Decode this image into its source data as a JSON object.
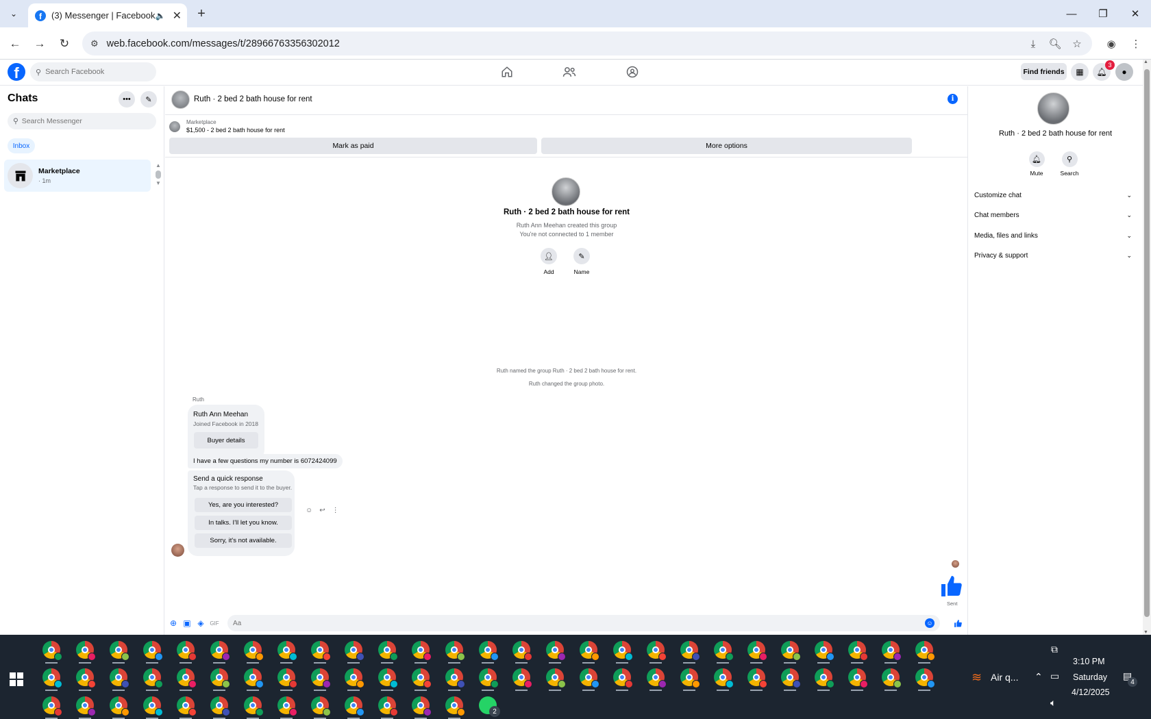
{
  "browser": {
    "tab_title": "(3) Messenger | Facebook",
    "url": "web.facebook.com/messages/t/28966763356302012"
  },
  "facebook": {
    "search_placeholder": "Search Facebook",
    "find_friends": "Find friends",
    "notification_count": "3"
  },
  "left": {
    "heading": "Chats",
    "search_placeholder": "Search Messenger",
    "filter": "Inbox",
    "chats": [
      {
        "name": "Marketplace",
        "time": "· 1m"
      }
    ]
  },
  "conversation": {
    "title": "Ruth · 2 bed 2 bath house for rent",
    "marketplace_label": "Marketplace",
    "listing": "$1,500 - 2 bed 2 bath house for rent",
    "mark_paid": "Mark as paid",
    "more_options": "More options",
    "hero_title": "Ruth · 2 bed 2 bath house for rent",
    "hero_created": "Ruth Ann Meehan created this group",
    "hero_connected": "You're not connected to 1 member",
    "add_label": "Add",
    "name_label": "Name",
    "system_messages": [
      "Ruth named the group Ruth · 2 bed 2 bath house for rent.",
      "Ruth changed the group photo."
    ],
    "sender": "Ruth",
    "card_name": "Ruth Ann Meehan",
    "card_joined": "Joined Facebook in 2018",
    "card_button": "Buyer details",
    "message": "I have a few questions my number is 6072424099",
    "quick_title": "Send a quick response",
    "quick_subtitle": "Tap a response to send it to the buyer.",
    "quick_responses": [
      "Yes, are you interested?",
      "In talks. I'll let you know.",
      "Sorry, it's not available."
    ],
    "sent_label": "Sent",
    "composer_placeholder": "Aa"
  },
  "right": {
    "title": "Ruth · 2 bed 2 bath house for rent",
    "mute": "Mute",
    "search": "Search",
    "sections": [
      "Customize chat",
      "Chat members",
      "Media, files and links",
      "Privacy & support"
    ]
  },
  "taskbar": {
    "weather": "Air q...",
    "time": "3:10 PM",
    "day": "Saturday",
    "date": "4/12/2025",
    "whatsapp_count": "2",
    "notification_count": "4"
  }
}
